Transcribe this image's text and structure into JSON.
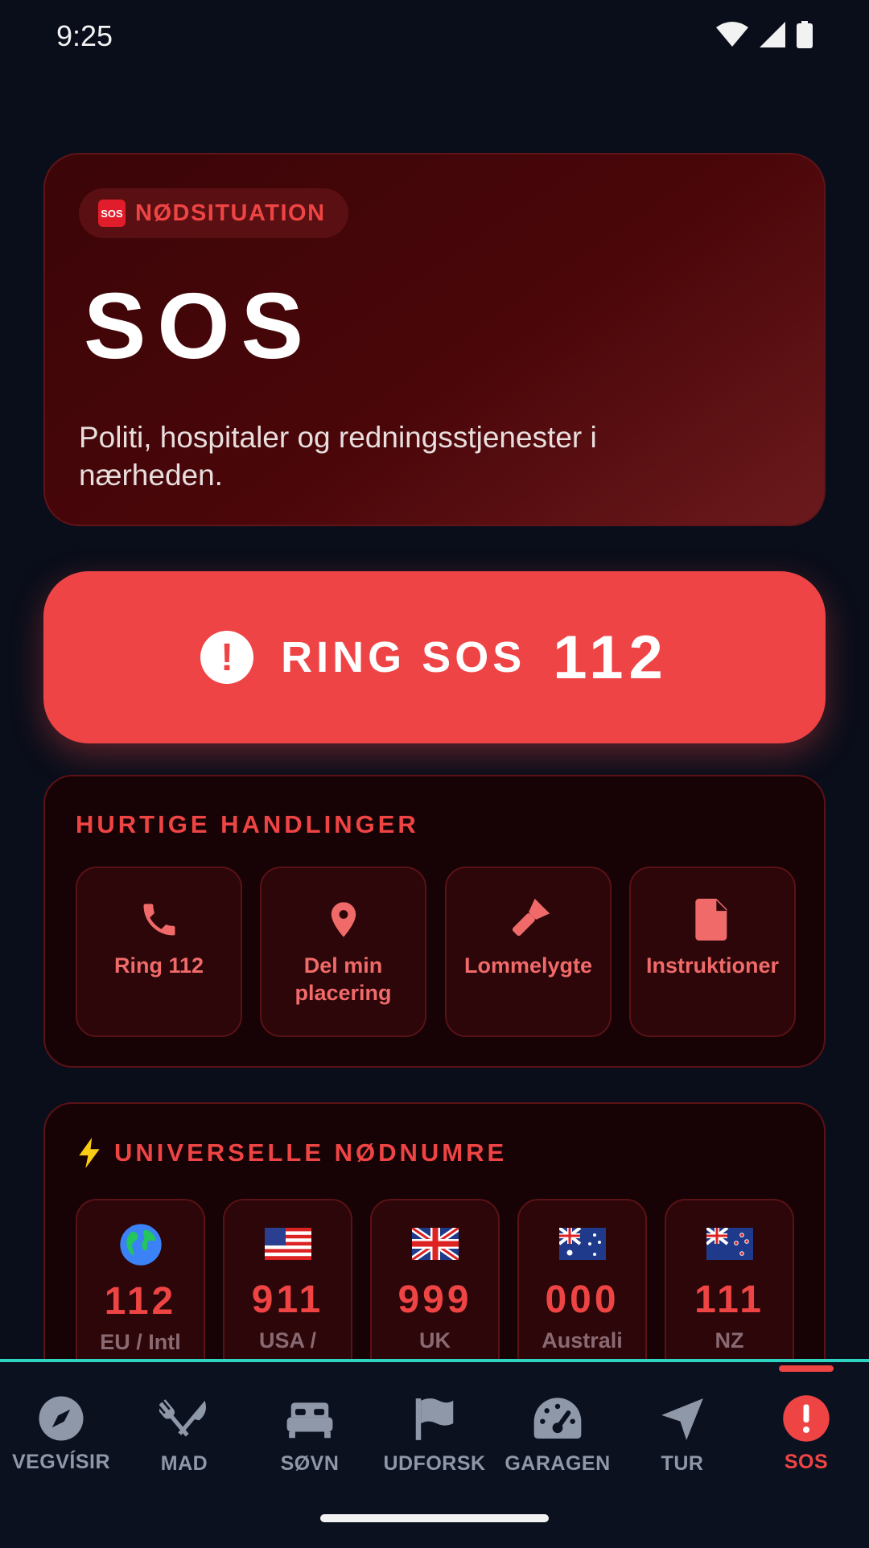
{
  "status": {
    "time": "9:25"
  },
  "hero": {
    "badge": "NØDSITUATION",
    "badge_emoji": "SOS",
    "title": "SOS",
    "description": "Politi, hospitaler og redningsstjenester i nærheden."
  },
  "call_button": {
    "label": "RING SOS",
    "number": "112"
  },
  "quick_actions": {
    "title": "HURTIGE HANDLINGER",
    "items": [
      {
        "label": "Ring 112",
        "icon": "phone-icon"
      },
      {
        "label": "Del min placering",
        "icon": "location-pin-icon"
      },
      {
        "label": "Lommelygte",
        "icon": "flashlight-icon"
      },
      {
        "label": "Instruktioner",
        "icon": "document-icon"
      }
    ]
  },
  "emergency_numbers": {
    "title": "UNIVERSELLE NØDNUMRE",
    "title_icon": "lightning-icon",
    "items": [
      {
        "number": "112",
        "region": "EU / Intl",
        "flag": "globe"
      },
      {
        "number": "911",
        "region": "USA /",
        "flag": "us"
      },
      {
        "number": "999",
        "region": "UK",
        "flag": "uk"
      },
      {
        "number": "000",
        "region": "Australi",
        "flag": "au"
      },
      {
        "number": "111",
        "region": "NZ",
        "flag": "nz"
      }
    ]
  },
  "nav": {
    "items": [
      {
        "label": "VEGVÍSIR",
        "icon": "compass-icon"
      },
      {
        "label": "MAD",
        "icon": "utensils-icon"
      },
      {
        "label": "SØVN",
        "icon": "bed-icon"
      },
      {
        "label": "UDFORSK",
        "icon": "flag-icon"
      },
      {
        "label": "GARAGEN",
        "icon": "gauge-icon"
      },
      {
        "label": "TUR",
        "icon": "navigation-arrow-icon"
      },
      {
        "label": "SOS",
        "icon": "alert-icon"
      }
    ],
    "active": "SOS"
  },
  "colors": {
    "accent": "#ef4444",
    "background": "#0a0e1a",
    "nav_divider": "#2dd4bf"
  }
}
